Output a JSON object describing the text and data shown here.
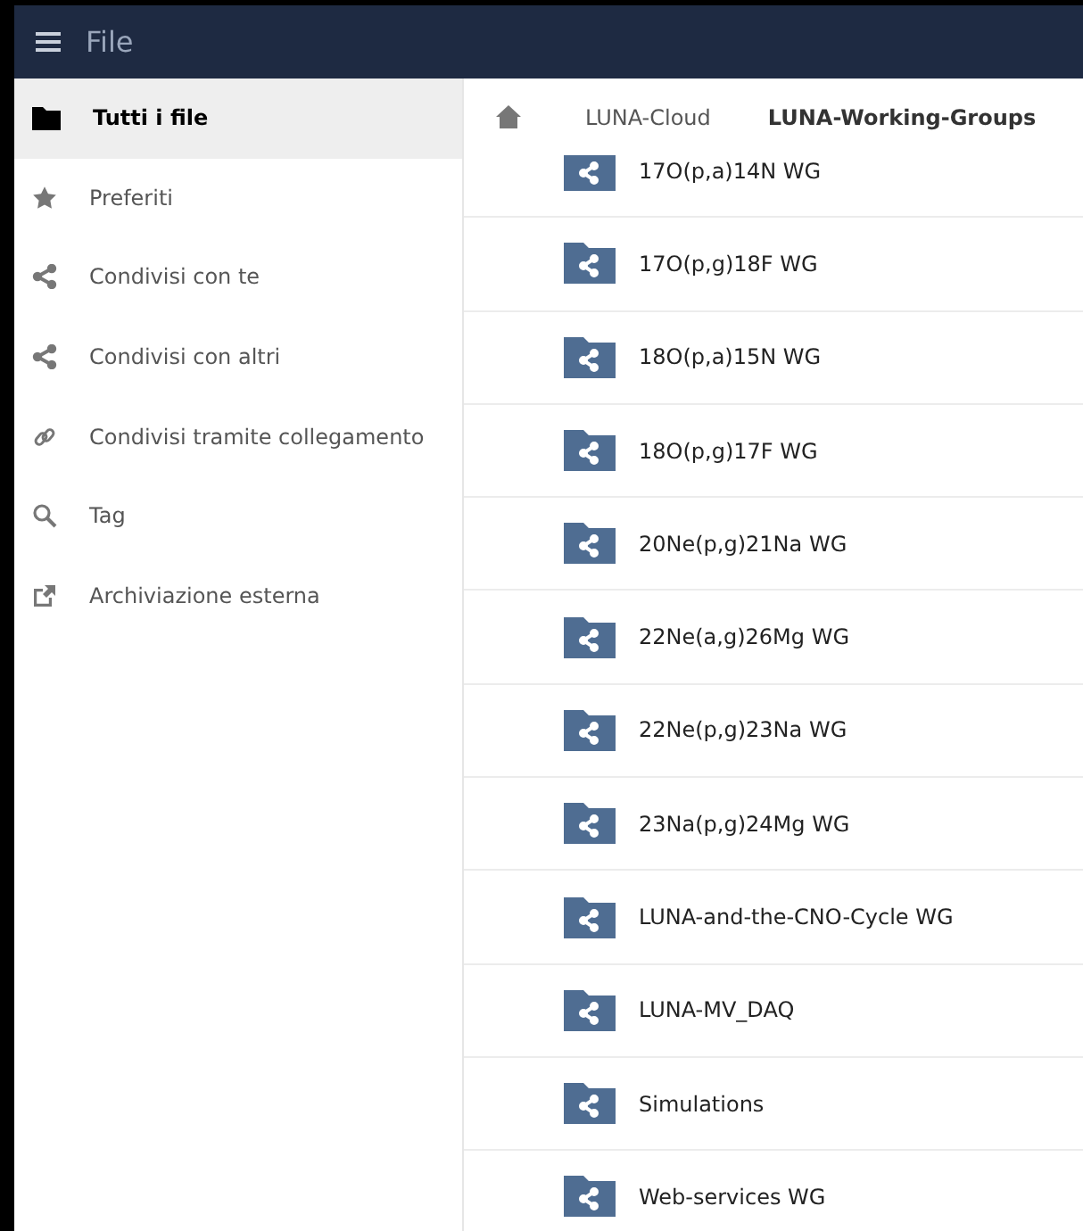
{
  "header": {
    "title": "File"
  },
  "sidebar": {
    "items": [
      {
        "label": "Tutti i file",
        "selected": true
      },
      {
        "label": "Preferiti",
        "selected": false
      },
      {
        "label": "Condivisi con te",
        "selected": false
      },
      {
        "label": "Condivisi con altri",
        "selected": false
      },
      {
        "label": "Condivisi tramite collegamento",
        "selected": false
      },
      {
        "label": "Tag",
        "selected": false
      },
      {
        "label": "Archiviazione esterna",
        "selected": false
      }
    ]
  },
  "breadcrumb": [
    "LUNA-Cloud",
    "LUNA-Working-Groups"
  ],
  "files": [
    "17O(p,a)14N WG",
    "17O(p,g)18F WG",
    "18O(p,a)15N WG",
    "18O(p,g)17F WG",
    "20Ne(p,g)21Na WG",
    "22Ne(a,g)26Mg WG",
    "22Ne(p,g)23Na WG",
    "23Na(p,g)24Mg WG",
    "LUNA-and-the-CNO-Cycle WG",
    "LUNA-MV_DAQ",
    "Simulations",
    "Web-services WG"
  ]
}
